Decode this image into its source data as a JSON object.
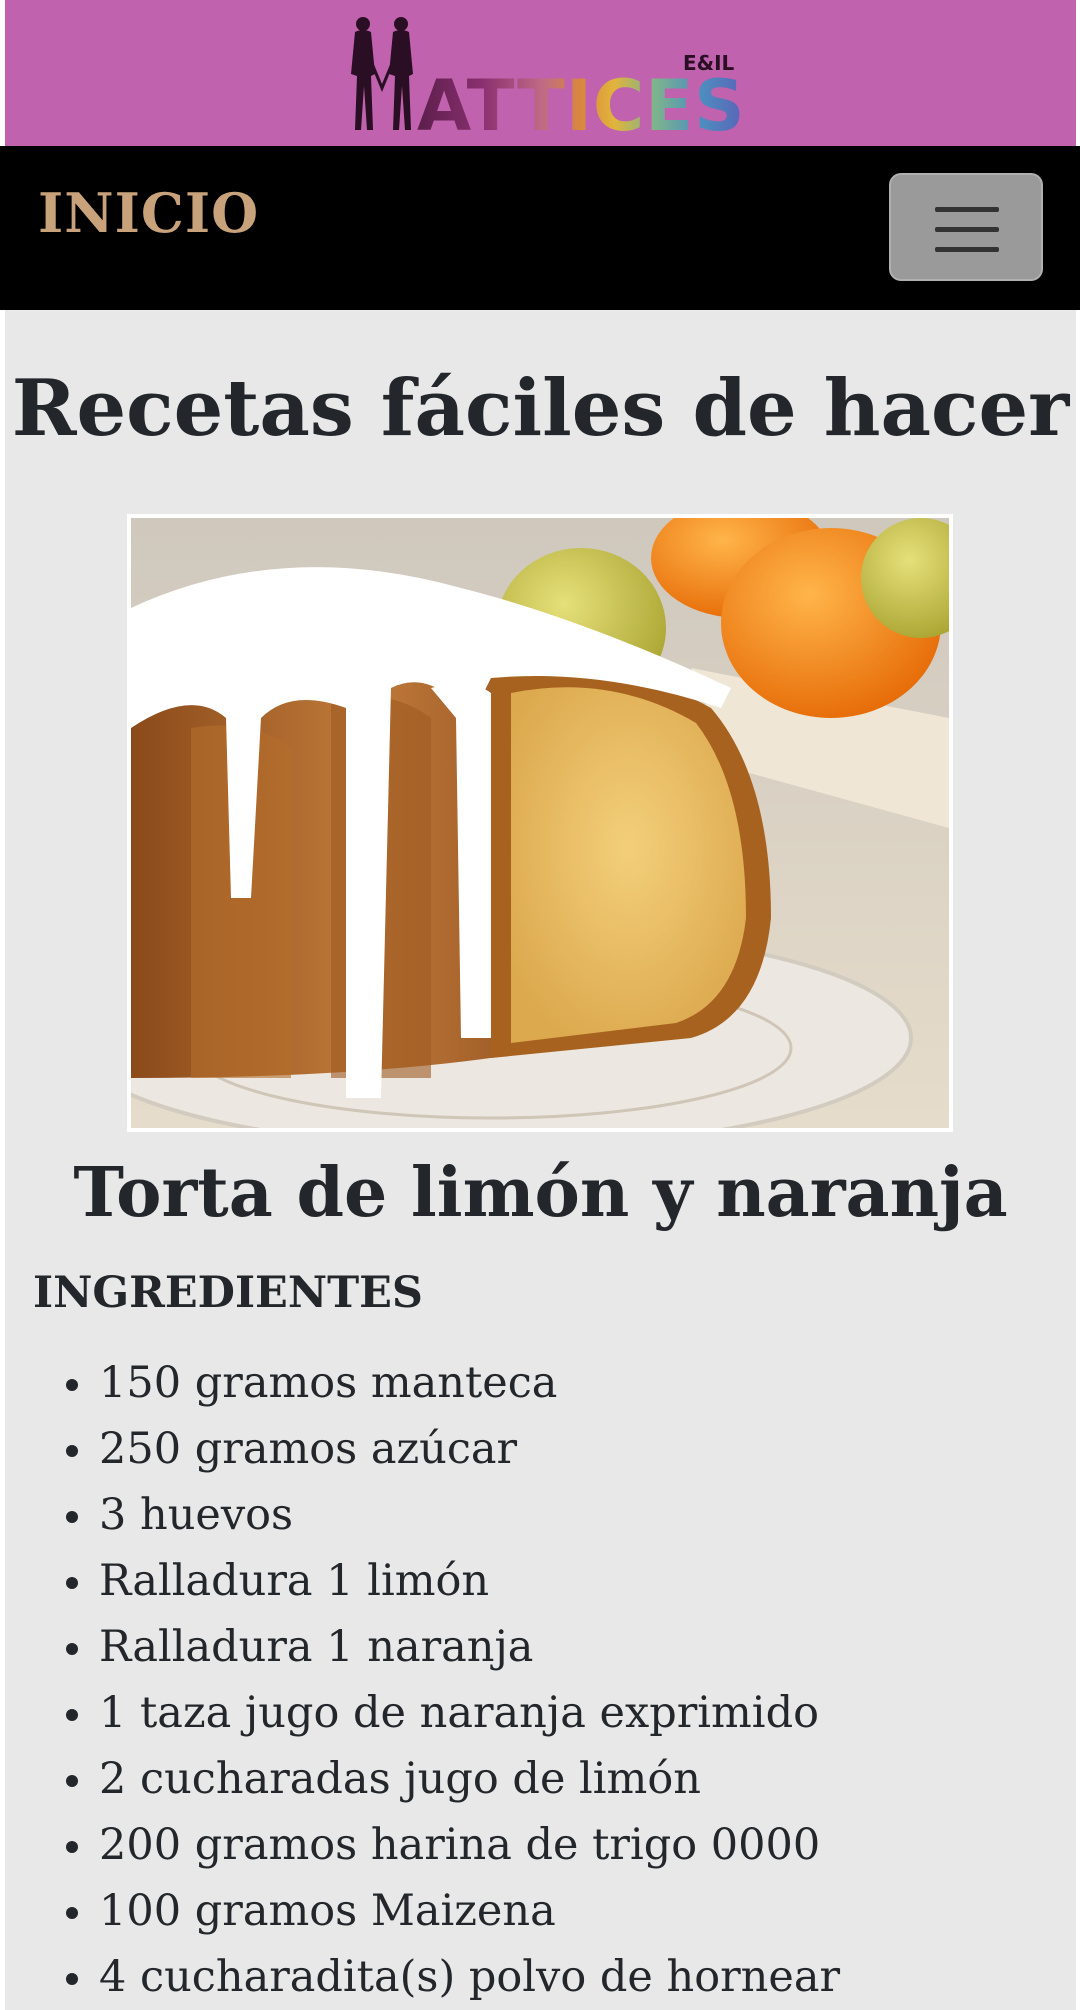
{
  "header": {
    "logo_main": "MATTICES",
    "logo_sub": "E&IL",
    "logo_colors": [
      "#5b1e4a",
      "#7d2a6a",
      "#c06a86",
      "#d9883e",
      "#e1b43c",
      "#7fb58a",
      "#4d8fbf",
      "#5b62b8"
    ]
  },
  "navbar": {
    "brand": "INICIO",
    "toggler_icon": "hamburger-menu-icon"
  },
  "main": {
    "page_title": "Recetas fáciles de hacer",
    "photo_subject": "orange-lemon-bundt-cake",
    "recipe_title": "Torta de limón y naranja",
    "ingredients_heading": "INGREDIENTES",
    "ingredients": [
      "150 gramos manteca",
      "250 gramos azúcar",
      "3 huevos",
      "Ralladura 1 limón",
      "Ralladura 1 naranja",
      "1 taza jugo de naranja exprimido",
      "2 cucharadas jugo de limón",
      "200 gramos harina de trigo 0000",
      "100 gramos Maizena",
      "4 cucharadita(s) polvo de hornear"
    ]
  },
  "colors": {
    "header_bg": "#c062ad",
    "navbar_bg": "#000000",
    "brand": "#c8a27a",
    "content_bg": "#e8e8e8",
    "text": "#23272b"
  }
}
